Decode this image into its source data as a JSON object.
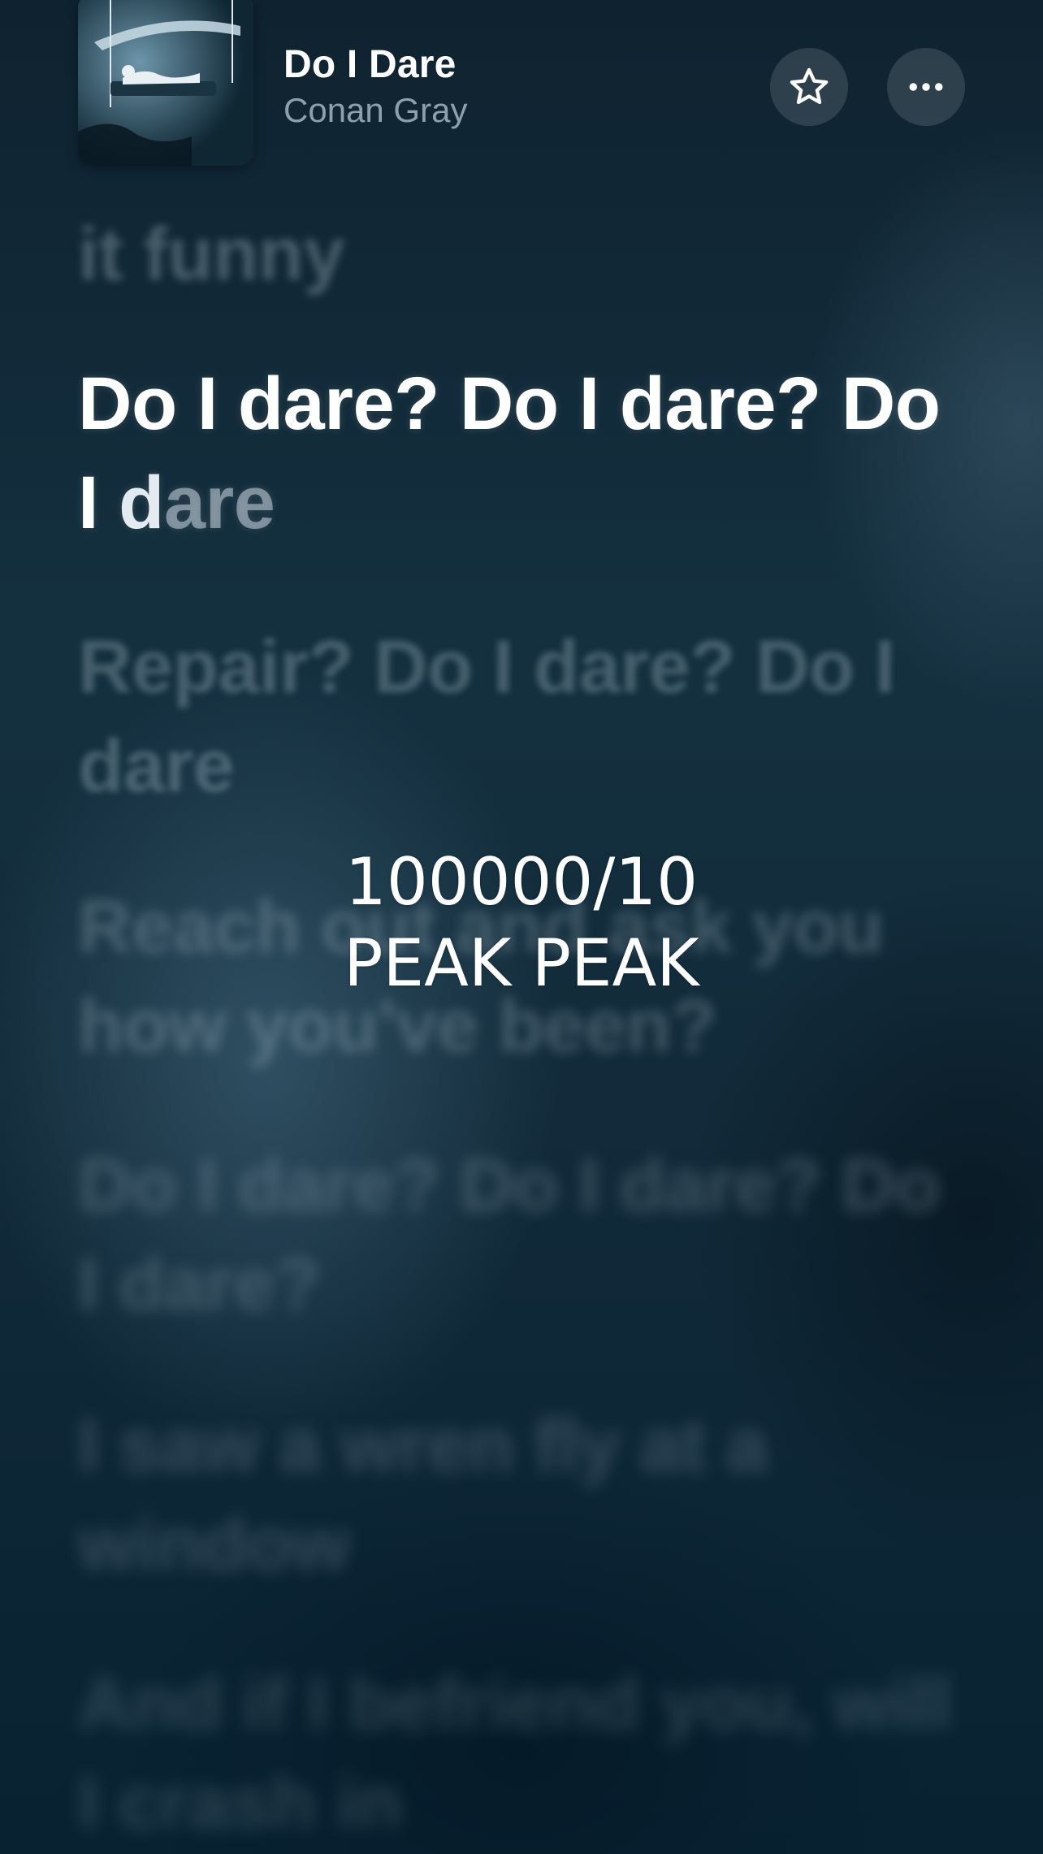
{
  "now_playing": {
    "title": "Do I Dare",
    "artist": "Conan Gray"
  },
  "buttons": {
    "favorite_icon": "star-outline-icon",
    "more_icon": "ellipsis-icon"
  },
  "lyrics": {
    "previous": "it funny",
    "current": {
      "sung": "Do I dare? Do I dare? Do I ",
      "in_progress": "d",
      "upcoming": "are"
    },
    "upcoming": [
      "Repair? Do I dare? Do I dare",
      "Reach out and ask you how you've been?",
      "Do I dare? Do I dare? Do I dare?",
      "I saw a wren fly at a window",
      "And if I befriend you, will I crash in"
    ]
  },
  "overlay_caption": {
    "line1": "100000/10",
    "line2": "PEAK PEAK"
  },
  "colors": {
    "background": "#0c2130",
    "active_lyric": "#ffffff",
    "secondary_text": "#bed0dc"
  }
}
